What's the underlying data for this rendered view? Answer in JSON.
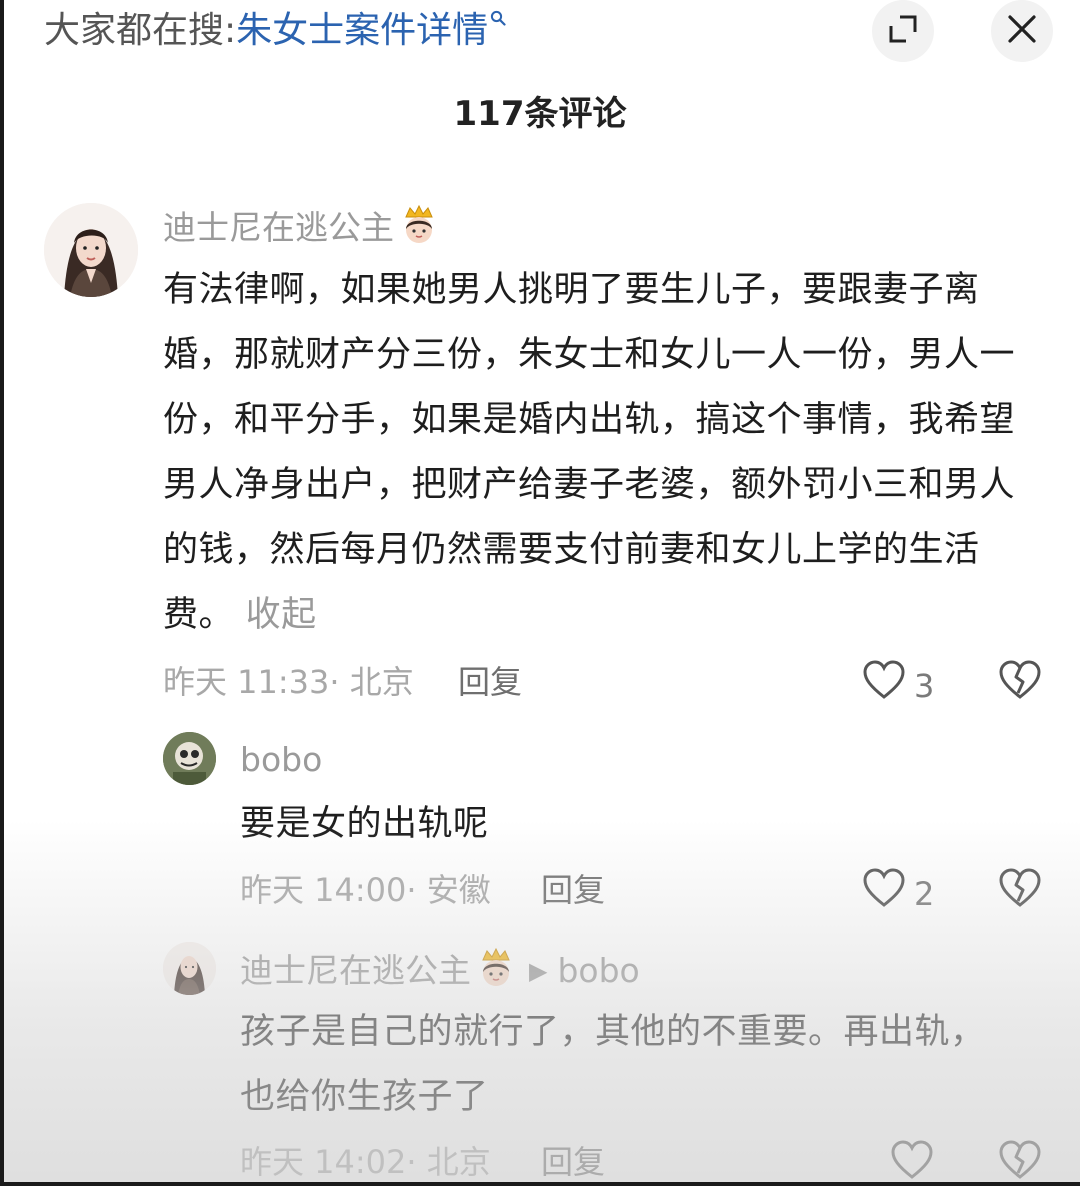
{
  "search": {
    "prefix": "大家都在搜:",
    "term": "朱女士案件详情"
  },
  "comments_header": "117条评论",
  "comments": [
    {
      "user": "迪士尼在逃公主",
      "text": "有法律啊，如果她男人挑明了要生儿子，要跟妻子离婚，那就财产分三份，朱女士和女儿一人一份，男人一份，和平分手，如果是婚内出轨，搞这个事情，我希望男人净身出户，把财产给妻子老婆，额外罚小三和男人的钱，然后每月仍然需要支付前妻和女儿上学的生活费。",
      "collapse_label": "收起",
      "meta": "昨天 11:33· 北京",
      "reply_label": "回复",
      "likes": "3"
    },
    {
      "user": "bobo",
      "text": "要是女的出轨呢",
      "meta": "昨天 14:00· 安徽",
      "reply_label": "回复",
      "likes": "2"
    },
    {
      "user": "迪士尼在逃公主",
      "reply_to": "bobo",
      "text": "孩子是自己的就行了，其他的不重要。再出轨，也给你生孩子了",
      "meta": "昨天 14:02· 北京",
      "reply_label": "回复",
      "likes": ""
    }
  ],
  "icons": {
    "search": "search-icon",
    "expand": "expand-icon",
    "close": "close-icon",
    "heart": "heart-icon",
    "broken_heart": "broken-heart-icon",
    "crown": "crown-princess-emoji"
  },
  "colors": {
    "search_term": "#2b63b0",
    "username": "#9a9a9a",
    "meta": "#a8a8a8"
  }
}
